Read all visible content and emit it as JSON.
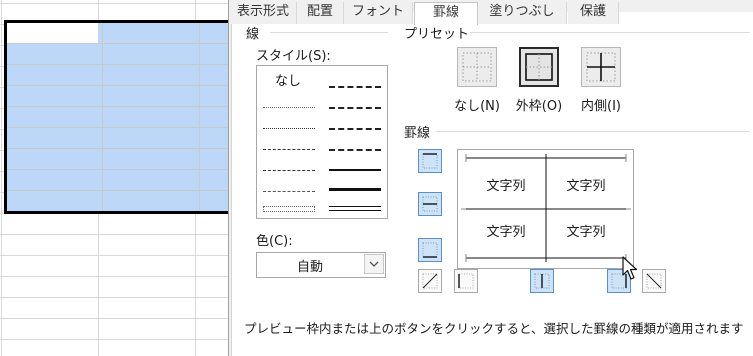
{
  "tabs": [
    "表示形式",
    "配置",
    "フォント",
    "罫線",
    "塗りつぶし",
    "保護"
  ],
  "active_tab": "罫線",
  "line_group": {
    "title": "線",
    "style_label": "スタイル(S):",
    "none_label": "なし",
    "color_label": "色(C):",
    "color_value": "自動"
  },
  "preset_group": {
    "title": "プリセット",
    "presets": [
      {
        "label": "なし(N)",
        "icon": "border-none-icon",
        "selected": false
      },
      {
        "label": "外枠(O)",
        "icon": "border-outline-icon",
        "selected": true
      },
      {
        "label": "内側(I)",
        "icon": "border-inside-icon",
        "selected": false
      }
    ]
  },
  "border_group": {
    "title": "罫線",
    "preview_cells": [
      "文字列",
      "文字列",
      "文字列",
      "文字列"
    ]
  },
  "hint_text": "プレビュー枠内または上のボタンをクリックすると、選択した罫線の種類が適用されます"
}
